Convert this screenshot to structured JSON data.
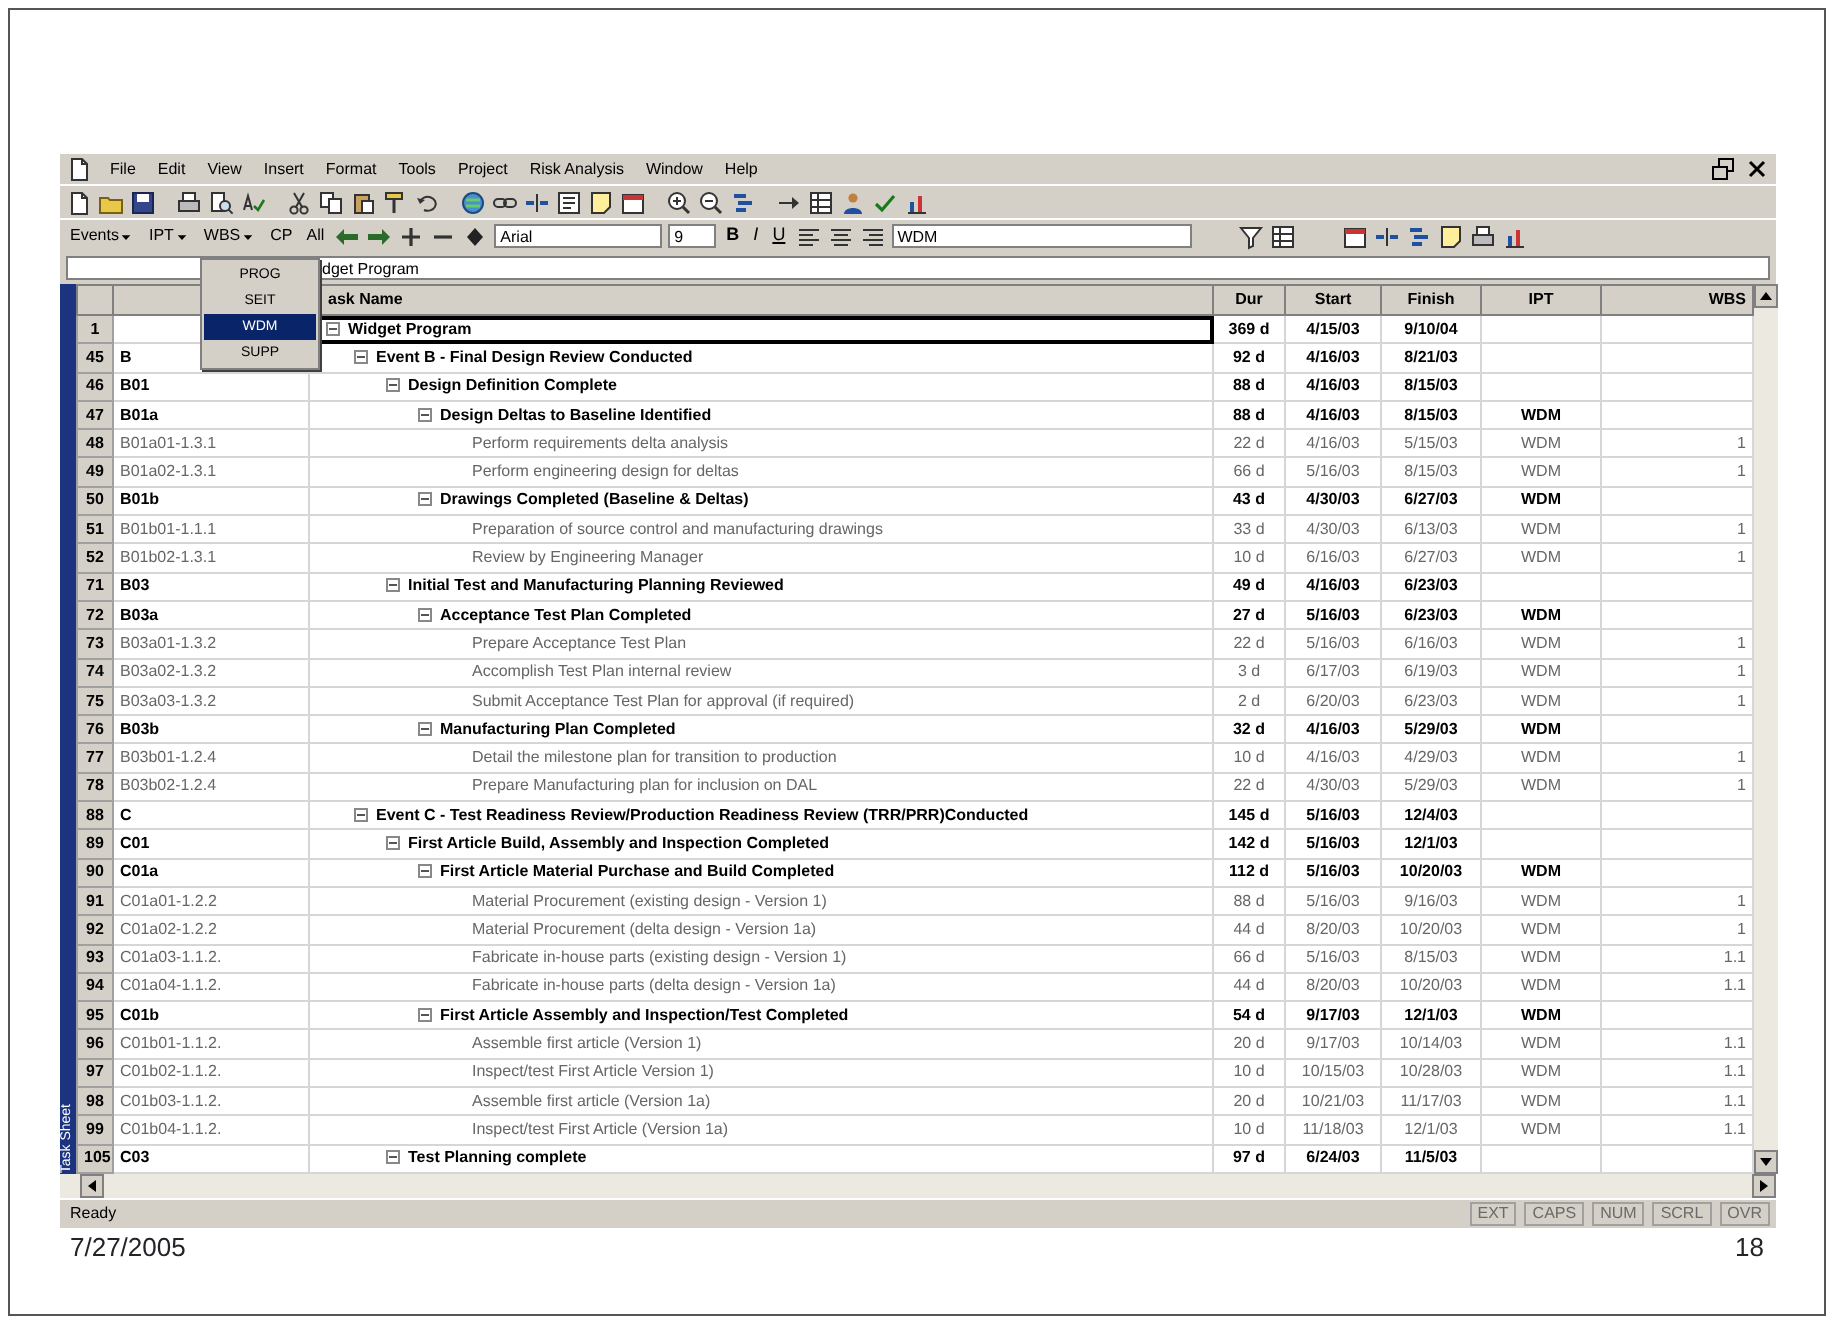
{
  "menu_bar": {
    "items": [
      "File",
      "Edit",
      "View",
      "Insert",
      "Format",
      "Tools",
      "Project",
      "Risk Analysis",
      "Window",
      "Help"
    ]
  },
  "format_toolbar": {
    "menus": [
      "Events",
      "IPT",
      "WBS"
    ],
    "buttons": [
      "CP",
      "All"
    ],
    "font": "Arial",
    "size": "9",
    "style_buttons": [
      "B",
      "I",
      "U"
    ],
    "field": "WDM"
  },
  "ipt_dropdown": {
    "options": [
      {
        "label": "PROG",
        "selected": false
      },
      {
        "label": "SEIT",
        "selected": false
      },
      {
        "label": "WDM",
        "selected": true
      },
      {
        "label": "SUPP",
        "selected": false
      }
    ]
  },
  "entry_bar": {
    "value": "dget Program"
  },
  "side_label": "Task Sheet",
  "table": {
    "columns": [
      "ask Name",
      "Dur",
      "Start",
      "Finish",
      "IPT",
      "WBS"
    ],
    "rows": [
      {
        "id": "1",
        "name": "Widget Program",
        "kind": "summary",
        "expanded": true,
        "selected": true,
        "dur": "369 d",
        "start": "4/15/03",
        "finish": "9/10/04",
        "children": [
          {
            "id": "45",
            "wbs": "B",
            "name": "Event B - Final Design Review Conducted",
            "kind": "summary",
            "expanded": true,
            "selected": false,
            "dur": "92 d",
            "start": "4/16/03",
            "finish": "8/21/03",
            "children": [
              {
                "id": "46",
                "wbs": "B01",
                "name": "Design Definition Complete",
                "kind": "summary",
                "expanded": true,
                "selected": false,
                "dur": "88 d",
                "start": "4/16/03",
                "finish": "8/15/03",
                "children": [
                  {
                    "id": "47",
                    "wbs": "B01a",
                    "name": "Design Deltas to Baseline Identified",
                    "kind": "summary",
                    "expanded": true,
                    "selected": false,
                    "dur": "88 d",
                    "start": "4/16/03",
                    "finish": "8/15/03",
                    "ipt": "WDM",
                    "children": [
                      {
                        "id": "48",
                        "wbs": "B01a01-1.3.1",
                        "name": "Perform requirements delta  analysis",
                        "kind": "task",
                        "selected": false,
                        "dur": "22 d",
                        "start": "4/16/03",
                        "finish": "5/15/03",
                        "ipt": "WDM",
                        "wbs_code": "1"
                      },
                      {
                        "id": "49",
                        "wbs": "B01a02-1.3.1",
                        "name": "Perform engineering design for deltas",
                        "kind": "task",
                        "selected": false,
                        "dur": "66 d",
                        "start": "5/16/03",
                        "finish": "8/15/03",
                        "ipt": "WDM",
                        "wbs_code": "1"
                      }
                    ]
                  },
                  {
                    "id": "50",
                    "wbs": "B01b",
                    "name": "Drawings Completed (Baseline & Deltas)",
                    "kind": "summary",
                    "expanded": true,
                    "selected": false,
                    "dur": "43 d",
                    "start": "4/30/03",
                    "finish": "6/27/03",
                    "ipt": "WDM",
                    "children": [
                      {
                        "id": "51",
                        "wbs": "B01b01-1.1.1",
                        "name": "Preparation of source control and manufacturing drawings",
                        "kind": "task",
                        "selected": false,
                        "dur": "33 d",
                        "start": "4/30/03",
                        "finish": "6/13/03",
                        "ipt": "WDM",
                        "wbs_code": "1"
                      },
                      {
                        "id": "52",
                        "wbs": "B01b02-1.3.1",
                        "name": "Review by Engineering Manager",
                        "kind": "task",
                        "selected": false,
                        "dur": "10 d",
                        "start": "6/16/03",
                        "finish": "6/27/03",
                        "ipt": "WDM",
                        "wbs_code": "1"
                      }
                    ]
                  }
                ]
              },
              {
                "id": "71",
                "wbs": "B03",
                "name": "Initial Test and Manufacturing Planning Reviewed",
                "kind": "summary",
                "expanded": true,
                "selected": false,
                "dur": "49 d",
                "start": "4/16/03",
                "finish": "6/23/03",
                "children": [
                  {
                    "id": "72",
                    "wbs": "B03a",
                    "name": "Acceptance Test Plan Completed",
                    "kind": "summary",
                    "expanded": true,
                    "selected": false,
                    "dur": "27 d",
                    "start": "5/16/03",
                    "finish": "6/23/03",
                    "ipt": "WDM",
                    "children": [
                      {
                        "id": "73",
                        "wbs": "B03a01-1.3.2",
                        "name": "Prepare Acceptance Test Plan",
                        "kind": "task",
                        "selected": false,
                        "dur": "22 d",
                        "start": "5/16/03",
                        "finish": "6/16/03",
                        "ipt": "WDM",
                        "wbs_code": "1"
                      },
                      {
                        "id": "74",
                        "wbs": "B03a02-1.3.2",
                        "name": "Accomplish Test Plan internal review",
                        "kind": "task",
                        "selected": false,
                        "dur": "3 d",
                        "start": "6/17/03",
                        "finish": "6/19/03",
                        "ipt": "WDM",
                        "wbs_code": "1"
                      },
                      {
                        "id": "75",
                        "wbs": "B03a03-1.3.2",
                        "name": "Submit Acceptance Test Plan for approval (if required)",
                        "kind": "task",
                        "selected": false,
                        "dur": "2 d",
                        "start": "6/20/03",
                        "finish": "6/23/03",
                        "ipt": "WDM",
                        "wbs_code": "1"
                      }
                    ]
                  },
                  {
                    "id": "76",
                    "wbs": "B03b",
                    "name": "Manufacturing Plan Completed",
                    "kind": "summary",
                    "expanded": true,
                    "selected": false,
                    "dur": "32 d",
                    "start": "4/16/03",
                    "finish": "5/29/03",
                    "ipt": "WDM",
                    "children": [
                      {
                        "id": "77",
                        "wbs": "B03b01-1.2.4",
                        "name": "Detail the milestone plan for transition to production",
                        "kind": "task",
                        "selected": false,
                        "dur": "10 d",
                        "start": "4/16/03",
                        "finish": "4/29/03",
                        "ipt": "WDM",
                        "wbs_code": "1"
                      },
                      {
                        "id": "78",
                        "wbs": "B03b02-1.2.4",
                        "name": "Prepare Manufacturing plan for inclusion on DAL",
                        "kind": "task",
                        "selected": false,
                        "dur": "22 d",
                        "start": "4/30/03",
                        "finish": "5/29/03",
                        "ipt": "WDM",
                        "wbs_code": "1"
                      }
                    ]
                  }
                ]
              }
            ]
          },
          {
            "id": "88",
            "wbs": "C",
            "name": "Event C - Test Readiness Review/Production Readiness Review  (TRR/PRR)Conducted",
            "kind": "summary",
            "expanded": true,
            "selected": false,
            "dur": "145 d",
            "start": "5/16/03",
            "finish": "12/4/03",
            "children": [
              {
                "id": "89",
                "wbs": "C01",
                "name": "First Article Build, Assembly and Inspection Completed",
                "kind": "summary",
                "expanded": true,
                "selected": false,
                "dur": "142 d",
                "start": "5/16/03",
                "finish": "12/1/03",
                "children": [
                  {
                    "id": "90",
                    "wbs": "C01a",
                    "name": "First Article Material Purchase and Build Completed",
                    "kind": "summary",
                    "expanded": true,
                    "selected": false,
                    "dur": "112 d",
                    "start": "5/16/03",
                    "finish": "10/20/03",
                    "ipt": "WDM",
                    "children": [
                      {
                        "id": "91",
                        "wbs": "C01a01-1.2.2",
                        "name": "Material Procurement (existing design - Version 1)",
                        "kind": "task",
                        "selected": false,
                        "dur": "88 d",
                        "start": "5/16/03",
                        "finish": "9/16/03",
                        "ipt": "WDM",
                        "wbs_code": "1"
                      },
                      {
                        "id": "92",
                        "wbs": "C01a02-1.2.2",
                        "name": "Material Procurement (delta design - Version 1a)",
                        "kind": "task",
                        "selected": false,
                        "dur": "44 d",
                        "start": "8/20/03",
                        "finish": "10/20/03",
                        "ipt": "WDM",
                        "wbs_code": "1"
                      },
                      {
                        "id": "93",
                        "wbs": "C01a03-1.1.2.",
                        "name": "Fabricate in-house parts (existing design - Version 1)",
                        "kind": "task",
                        "selected": false,
                        "dur": "66 d",
                        "start": "5/16/03",
                        "finish": "8/15/03",
                        "ipt": "WDM",
                        "wbs_code": "1.1"
                      },
                      {
                        "id": "94",
                        "wbs": "C01a04-1.1.2.",
                        "name": "Fabricate in-house parts (delta design - Version 1a)",
                        "kind": "task",
                        "selected": false,
                        "dur": "44 d",
                        "start": "8/20/03",
                        "finish": "10/20/03",
                        "ipt": "WDM",
                        "wbs_code": "1.1"
                      }
                    ]
                  },
                  {
                    "id": "95",
                    "wbs": "C01b",
                    "name": "First Article Assembly and Inspection/Test Completed",
                    "kind": "summary",
                    "expanded": true,
                    "selected": false,
                    "dur": "54 d",
                    "start": "9/17/03",
                    "finish": "12/1/03",
                    "ipt": "WDM",
                    "children": [
                      {
                        "id": "96",
                        "wbs": "C01b01-1.1.2.",
                        "name": "Assemble first article (Version 1)",
                        "kind": "task",
                        "selected": false,
                        "dur": "20 d",
                        "start": "9/17/03",
                        "finish": "10/14/03",
                        "ipt": "WDM",
                        "wbs_code": "1.1"
                      },
                      {
                        "id": "97",
                        "wbs": "C01b02-1.1.2.",
                        "name": "Inspect/test First Article Version 1)",
                        "kind": "task",
                        "selected": false,
                        "dur": "10 d",
                        "start": "10/15/03",
                        "finish": "10/28/03",
                        "ipt": "WDM",
                        "wbs_code": "1.1"
                      },
                      {
                        "id": "98",
                        "wbs": "C01b03-1.1.2.",
                        "name": "Assemble first article (Version 1a)",
                        "kind": "task",
                        "selected": false,
                        "dur": "20 d",
                        "start": "10/21/03",
                        "finish": "11/17/03",
                        "ipt": "WDM",
                        "wbs_code": "1.1"
                      },
                      {
                        "id": "99",
                        "wbs": "C01b04-1.1.2.",
                        "name": "Inspect/test First Article (Version 1a)",
                        "kind": "task",
                        "selected": false,
                        "dur": "10 d",
                        "start": "11/18/03",
                        "finish": "12/1/03",
                        "ipt": "WDM",
                        "wbs_code": "1.1"
                      }
                    ]
                  }
                ]
              },
              {
                "id": "105",
                "wbs": "C03",
                "name": "Test Planning complete",
                "kind": "summary",
                "expanded": true,
                "selected": false,
                "dur": "97 d",
                "start": "6/24/03",
                "finish": "11/5/03"
              }
            ]
          }
        ]
      }
    ]
  },
  "status_bar": {
    "text": "Ready",
    "indicators": [
      {
        "label": "EXT",
        "on": false
      },
      {
        "label": "CAPS",
        "on": false
      },
      {
        "label": "NUM",
        "on": false
      },
      {
        "label": "SCRL",
        "on": false
      },
      {
        "label": "OVR",
        "on": false
      }
    ]
  },
  "slide_footer": {
    "date": "7/27/2005",
    "page": "18"
  }
}
